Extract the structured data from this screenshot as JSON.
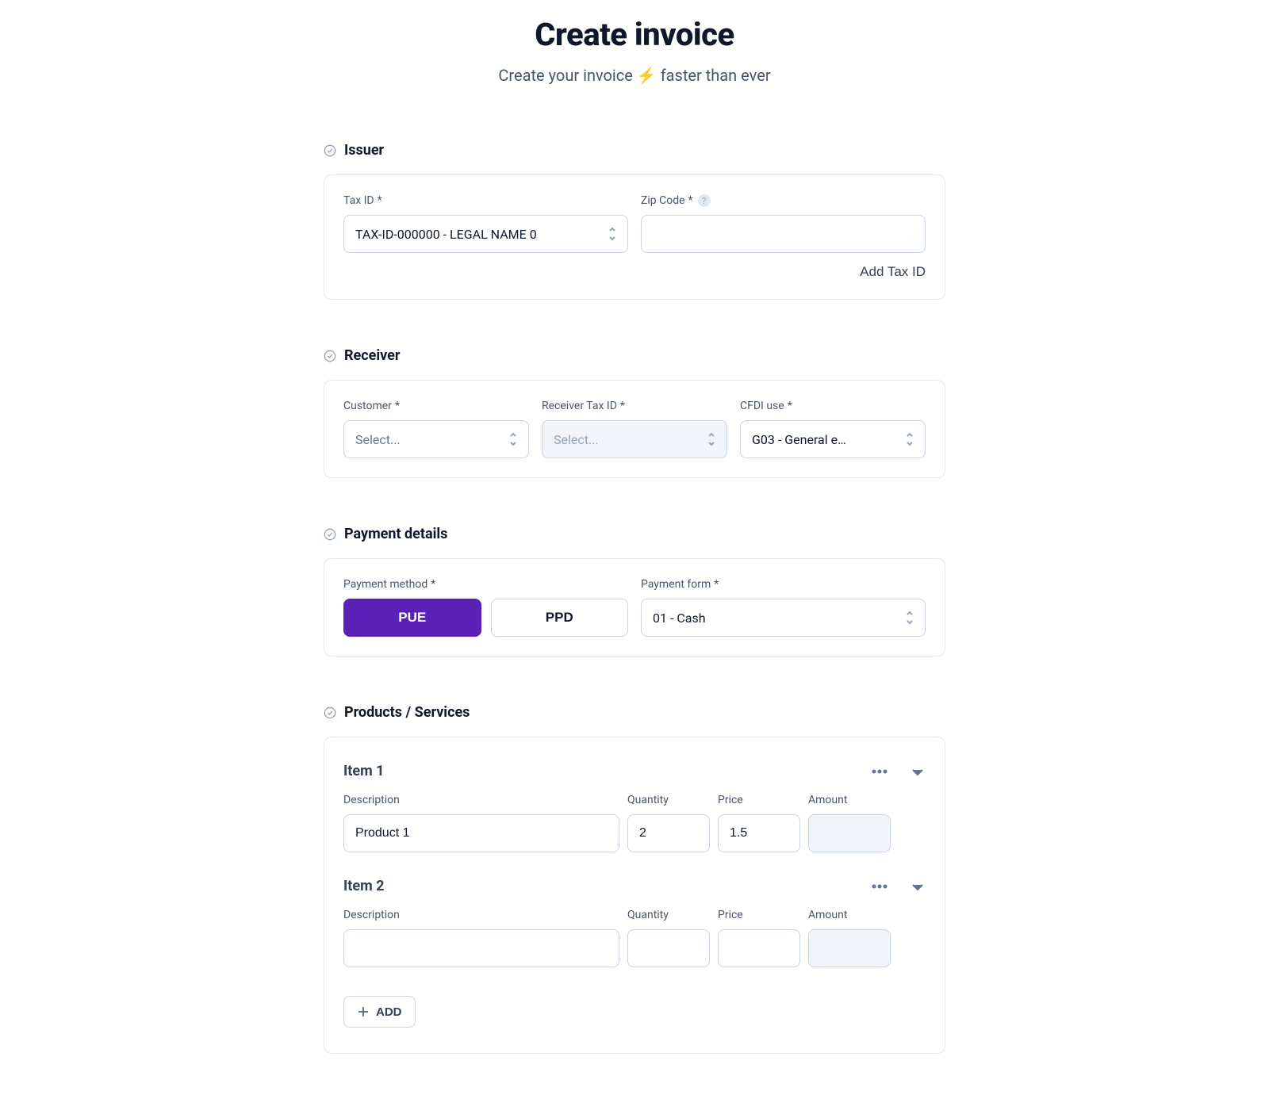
{
  "header": {
    "title": "Create invoice",
    "subtitle": "Create your invoice ⚡ faster than ever"
  },
  "sections": {
    "issuer": {
      "title": "Issuer",
      "taxId": {
        "label": "Tax ID",
        "required": "*",
        "value": "TAX-ID-000000 - LEGAL NAME 0"
      },
      "zipCode": {
        "label": "Zip Code",
        "required": "*",
        "help": "?",
        "value": ""
      },
      "addTaxIdLabel": "Add Tax ID"
    },
    "receiver": {
      "title": "Receiver",
      "customer": {
        "label": "Customer",
        "required": "*",
        "placeholder": "Select..."
      },
      "receiverTaxId": {
        "label": "Receiver Tax ID",
        "required": "*",
        "placeholder": "Select...",
        "disabled": true
      },
      "cfdiUse": {
        "label": "CFDI use",
        "required": "*",
        "value": "G03 - General e…"
      }
    },
    "payment": {
      "title": "Payment details",
      "method": {
        "label": "Payment method",
        "required": "*",
        "options": [
          "PUE",
          "PPD"
        ],
        "selected": "PUE"
      },
      "form": {
        "label": "Payment form",
        "required": "*",
        "value": "01 - Cash"
      }
    },
    "products": {
      "title": "Products / Services",
      "columns": {
        "description": "Description",
        "quantity": "Quantity",
        "price": "Price",
        "amount": "Amount"
      },
      "items": [
        {
          "title": "Item 1",
          "description": "Product 1",
          "quantity": "2",
          "price": "1.5",
          "amount": ""
        },
        {
          "title": "Item 2",
          "description": "",
          "quantity": "",
          "price": "",
          "amount": ""
        }
      ],
      "addLabel": "ADD"
    }
  }
}
